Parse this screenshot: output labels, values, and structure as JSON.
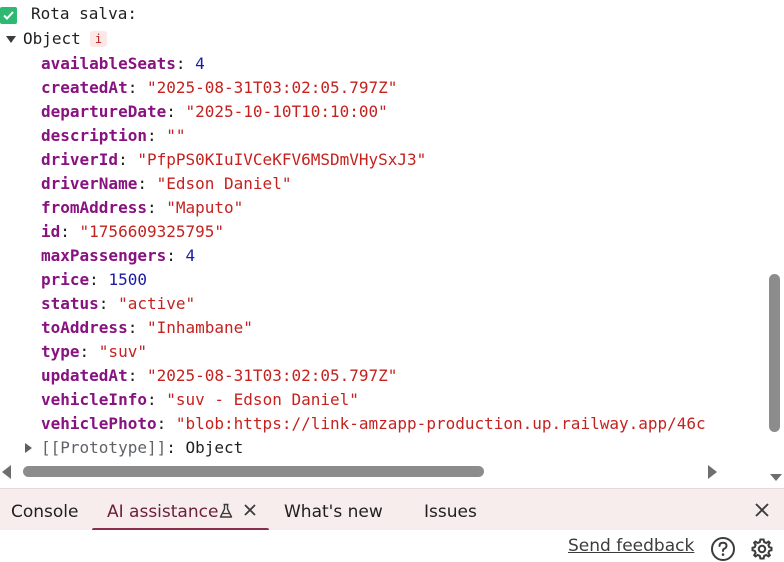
{
  "log": {
    "message": "Rota salva:",
    "object_label": "Object",
    "info_badge": "i"
  },
  "properties": [
    {
      "key": "availableSeats",
      "value": "4",
      "type": "number"
    },
    {
      "key": "createdAt",
      "value": "\"2025-08-31T03:02:05.797Z\"",
      "type": "string"
    },
    {
      "key": "departureDate",
      "value": "\"2025-10-10T10:10:00\"",
      "type": "string"
    },
    {
      "key": "description",
      "value": "\"\"",
      "type": "string"
    },
    {
      "key": "driverId",
      "value": "\"PfpPS0KIuIVCeKFV6MSDmVHySxJ3\"",
      "type": "string"
    },
    {
      "key": "driverName",
      "value": "\"Edson Daniel\"",
      "type": "string"
    },
    {
      "key": "fromAddress",
      "value": "\"Maputo\"",
      "type": "string"
    },
    {
      "key": "id",
      "value": "\"1756609325795\"",
      "type": "string"
    },
    {
      "key": "maxPassengers",
      "value": "4",
      "type": "number"
    },
    {
      "key": "price",
      "value": "1500",
      "type": "number"
    },
    {
      "key": "status",
      "value": "\"active\"",
      "type": "string"
    },
    {
      "key": "toAddress",
      "value": "\"Inhambane\"",
      "type": "string"
    },
    {
      "key": "type",
      "value": "\"suv\"",
      "type": "string"
    },
    {
      "key": "updatedAt",
      "value": "\"2025-08-31T03:02:05.797Z\"",
      "type": "string"
    },
    {
      "key": "vehicleInfo",
      "value": "\"suv - Edson Daniel\"",
      "type": "string"
    },
    {
      "key": "vehiclePhoto",
      "value": "\"blob:https://link-amzapp-production.up.railway.app/46c",
      "type": "string"
    }
  ],
  "prototype": {
    "key": "[[Prototype]]",
    "value": "Object"
  },
  "drawer": {
    "tabs": [
      {
        "label": "Console"
      },
      {
        "label": "AI assistance"
      },
      {
        "label": "What's new"
      },
      {
        "label": "Issues"
      }
    ],
    "active_tab": "AI assistance"
  },
  "footer": {
    "send_feedback": "Send feedback"
  },
  "colors": {
    "key": "#881280",
    "string": "#c5221f",
    "number": "#1a1aa6",
    "success": "#2eb872",
    "drawer_bg": "#f8eded",
    "active_tab_underline": "#8b2e4e"
  },
  "icons": [
    "check-icon",
    "expand-triangle-icon",
    "info-icon",
    "collapse-triangle-icon",
    "flask-icon",
    "close-icon",
    "help-icon",
    "gear-icon"
  ]
}
